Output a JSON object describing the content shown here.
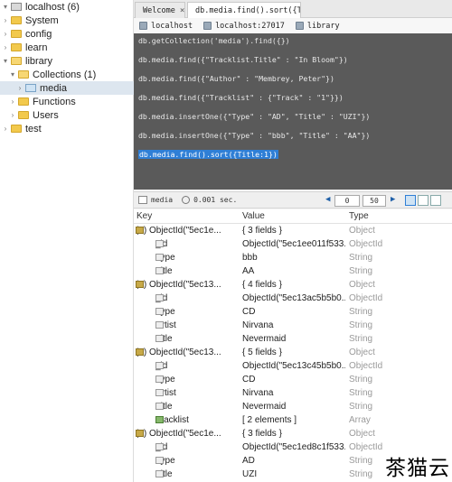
{
  "tree": {
    "items": [
      {
        "label": "localhost (6)",
        "kind": "server",
        "expanded": true
      },
      {
        "label": "System",
        "kind": "folder",
        "expanded": false
      },
      {
        "label": "config",
        "kind": "folder",
        "expanded": false
      },
      {
        "label": "learn",
        "kind": "folder",
        "expanded": false
      },
      {
        "label": "library",
        "kind": "folder",
        "expanded": true
      },
      {
        "label": "Collections (1)",
        "kind": "folder",
        "expanded": true
      },
      {
        "label": "media",
        "kind": "collection",
        "selected": true
      },
      {
        "label": "Functions",
        "kind": "folder",
        "expanded": false
      },
      {
        "label": "Users",
        "kind": "folder",
        "expanded": false
      },
      {
        "label": "test",
        "kind": "folder",
        "expanded": false
      }
    ]
  },
  "tabs": [
    {
      "label": "Welcome",
      "close": "×",
      "active": false
    },
    {
      "label": "db.media.find().sort({T…",
      "close": "×",
      "active": true
    }
  ],
  "breadcrumbs": [
    "localhost",
    "localhost:27017",
    "library"
  ],
  "editor": {
    "lines": [
      "db.getCollection('media').find({})",
      "db.media.find({\"Tracklist.Title\" : \"In Bloom\"})",
      "db.media.find({\"Author\" : \"Membrey, Peter\"})",
      "db.media.find({\"Tracklist\" : {\"Track\" : \"1\"}})",
      "db.media.insertOne({\"Type\" : \"AD\", \"Title\" : \"UZI\"})",
      "db.media.insertOne({\"Type\" : \"bbb\", \"Title\" : \"AA\"})",
      "db.media.find().sort({Title:1})"
    ],
    "highlighted_line": 6
  },
  "results_toolbar": {
    "collection": "media",
    "time": "0.001 sec.",
    "page_start": "0",
    "page_size": "50"
  },
  "grid": {
    "columns": [
      "Key",
      "Value",
      "Type"
    ],
    "rows": [
      {
        "level": 0,
        "caret": "v",
        "icon": "doc",
        "key": "(1) ObjectId(\"5ec1e...",
        "value": "{ 3 fields }",
        "type": "Object"
      },
      {
        "level": 1,
        "caret": "",
        "icon": "fld",
        "key": "_id",
        "value": "ObjectId(\"5ec1ee011f533...",
        "type": "ObjectId"
      },
      {
        "level": 1,
        "caret": "",
        "icon": "fld",
        "key": "Type",
        "value": "bbb",
        "type": "String"
      },
      {
        "level": 1,
        "caret": "",
        "icon": "fld",
        "key": "Title",
        "value": "AA",
        "type": "String"
      },
      {
        "level": 0,
        "caret": "v",
        "icon": "doc",
        "key": "(2) ObjectId(\"5ec13...",
        "value": "{ 4 fields }",
        "type": "Object"
      },
      {
        "level": 1,
        "caret": "",
        "icon": "fld",
        "key": "_id",
        "value": "ObjectId(\"5ec13ac5b5b0...",
        "type": "ObjectId"
      },
      {
        "level": 1,
        "caret": "",
        "icon": "fld",
        "key": "Type",
        "value": "CD",
        "type": "String"
      },
      {
        "level": 1,
        "caret": "",
        "icon": "fld",
        "key": "Artist",
        "value": "Nirvana",
        "type": "String"
      },
      {
        "level": 1,
        "caret": "",
        "icon": "fld",
        "key": "Title",
        "value": "Nevermaid",
        "type": "String"
      },
      {
        "level": 0,
        "caret": "v",
        "icon": "doc",
        "key": "(3) ObjectId(\"5ec13...",
        "value": "{ 5 fields }",
        "type": "Object"
      },
      {
        "level": 1,
        "caret": "",
        "icon": "fld",
        "key": "_id",
        "value": "ObjectId(\"5ec13c45b5b0...",
        "type": "ObjectId"
      },
      {
        "level": 1,
        "caret": "",
        "icon": "fld",
        "key": "Type",
        "value": "CD",
        "type": "String"
      },
      {
        "level": 1,
        "caret": "",
        "icon": "fld",
        "key": "Artist",
        "value": "Nirvana",
        "type": "String"
      },
      {
        "level": 1,
        "caret": "",
        "icon": "fld",
        "key": "Title",
        "value": "Nevermaid",
        "type": "String"
      },
      {
        "level": 1,
        "caret": ">",
        "icon": "arr",
        "key": "Tracklist",
        "value": "[ 2 elements ]",
        "type": "Array"
      },
      {
        "level": 0,
        "caret": "v",
        "icon": "doc",
        "key": "(4) ObjectId(\"5ec1e...",
        "value": "{ 3 fields }",
        "type": "Object"
      },
      {
        "level": 1,
        "caret": "",
        "icon": "fld",
        "key": "_id",
        "value": "ObjectId(\"5ec1ed8c1f533...",
        "type": "ObjectId"
      },
      {
        "level": 1,
        "caret": "",
        "icon": "fld",
        "key": "Type",
        "value": "AD",
        "type": "String"
      },
      {
        "level": 1,
        "caret": "",
        "icon": "fld",
        "key": "Title",
        "value": "UZI",
        "type": "String"
      }
    ]
  },
  "watermark": "茶猫云"
}
